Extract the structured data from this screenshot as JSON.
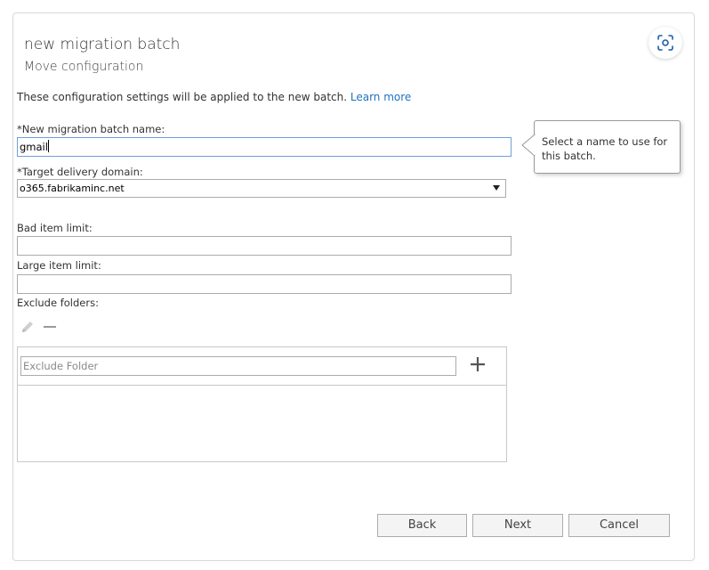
{
  "header": {
    "title": "new migration batch",
    "subtitle": "Move configuration"
  },
  "description": {
    "text": "These configuration settings will be applied to the new batch.",
    "link": "Learn more"
  },
  "fields": {
    "batch_name": {
      "label": "*New migration batch name:",
      "value": "gmail"
    },
    "target_domain": {
      "label": "*Target delivery domain:",
      "value": "o365.fabrikaminc.net"
    },
    "bad_item_limit": {
      "label": "Bad item limit:",
      "value": ""
    },
    "large_item_limit": {
      "label": "Large item limit:",
      "value": ""
    },
    "exclude_folders": {
      "label": "Exclude folders:",
      "placeholder": "Exclude Folder"
    }
  },
  "callout": {
    "text": "Select a name to use for this batch."
  },
  "buttons": {
    "back": "Back",
    "next": "Next",
    "cancel": "Cancel"
  },
  "icons": {
    "expand": "focus-expand-icon",
    "edit": "pencil-icon",
    "remove": "minus-icon",
    "add": "plus-icon"
  },
  "colors": {
    "link": "#1e73be",
    "focus_border": "#6f9fd8"
  }
}
